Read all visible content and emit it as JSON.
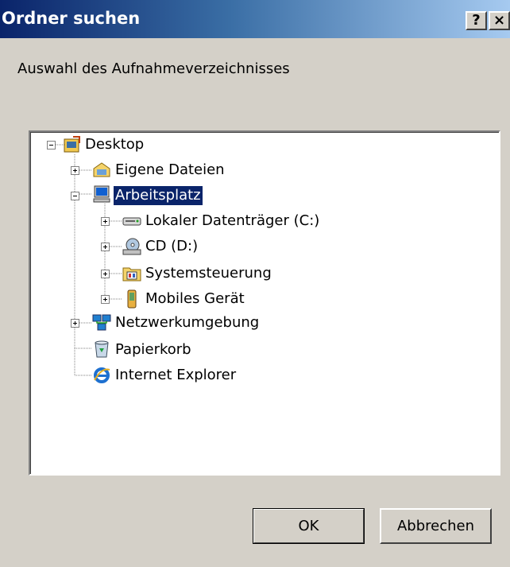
{
  "window": {
    "title": "Ordner suchen",
    "help_button": "?",
    "close_button": "×"
  },
  "dialog": {
    "instruction": "Auswahl des Aufnahmeverzeichnisses"
  },
  "tree": {
    "items": [
      {
        "label": "Desktop",
        "icon": "desktop-icon",
        "state": "expanded",
        "level": 0
      },
      {
        "label": "Eigene Dateien",
        "icon": "my-documents-icon",
        "state": "collapsed",
        "level": 1
      },
      {
        "label": "Arbeitsplatz",
        "icon": "my-computer-icon",
        "state": "expanded",
        "level": 1,
        "selected": true
      },
      {
        "label": "Lokaler Datenträger (C:)",
        "icon": "hard-drive-icon",
        "state": "collapsed",
        "level": 2
      },
      {
        "label": "CD (D:)",
        "icon": "cd-drive-icon",
        "state": "collapsed",
        "level": 2
      },
      {
        "label": "Systemsteuerung",
        "icon": "control-panel-icon",
        "state": "collapsed",
        "level": 2
      },
      {
        "label": "Mobiles Gerät",
        "icon": "mobile-device-icon",
        "state": "collapsed",
        "level": 2
      },
      {
        "label": "Netzwerkumgebung",
        "icon": "network-icon",
        "state": "collapsed",
        "level": 1
      },
      {
        "label": "Papierkorb",
        "icon": "recycle-bin-icon",
        "state": "leaf",
        "level": 1
      },
      {
        "label": "Internet Explorer",
        "icon": "internet-explorer-icon",
        "state": "leaf",
        "level": 1
      }
    ]
  },
  "buttons": {
    "ok": "OK",
    "cancel": "Abbrechen"
  },
  "colors": {
    "selection": "#0a246a",
    "titlebar_start": "#0a246a",
    "titlebar_end": "#a6caf0",
    "face": "#d4d0c8"
  }
}
